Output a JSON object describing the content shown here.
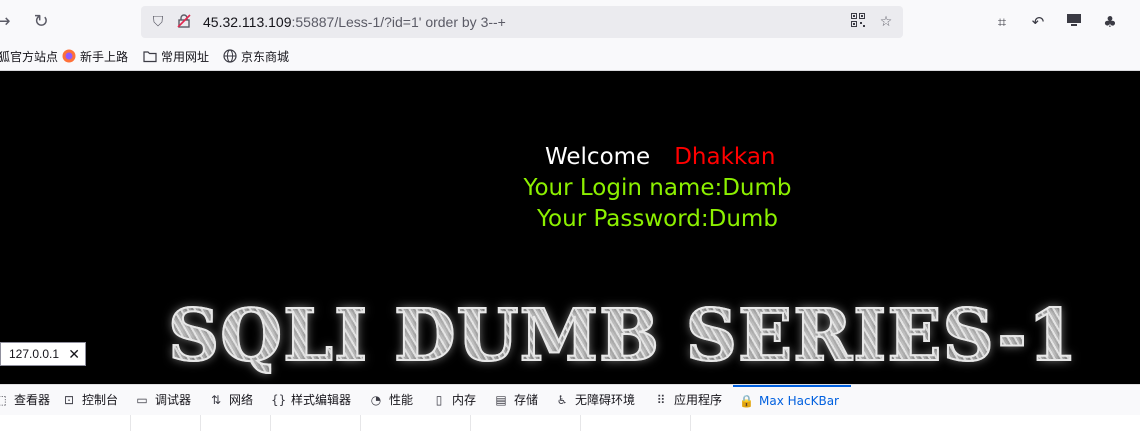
{
  "toolbar": {
    "back_icon": "arrow-right-icon",
    "reload_icon": "reload-icon",
    "url_host": "45.32.113.109",
    "url_rest": ":55887/Less-1/?id=1' order by 3--+"
  },
  "bookmarks": [
    {
      "label": "火狐官方站点",
      "icon": "firefox-icon"
    },
    {
      "label": "新手上路",
      "icon": "firefox-icon"
    },
    {
      "label": "常用网址",
      "icon": "folder-icon"
    },
    {
      "label": "京东商城",
      "icon": "globe-icon"
    }
  ],
  "page": {
    "welcome": "Welcome",
    "name": "Dhakkan",
    "login_line": "Your Login name:Dumb",
    "password_line": "Your Password:Dumb",
    "banner": "SQLI DUMB SERIES-1",
    "ip": "127.0.0.1"
  },
  "devtools": {
    "tabs": [
      {
        "label": "查看器",
        "icon": "inspector-icon"
      },
      {
        "label": "控制台",
        "icon": "console-icon"
      },
      {
        "label": "调试器",
        "icon": "debugger-icon"
      },
      {
        "label": "网络",
        "icon": "network-icon"
      },
      {
        "label": "样式编辑器",
        "icon": "style-editor-icon"
      },
      {
        "label": "性能",
        "icon": "performance-icon"
      },
      {
        "label": "内存",
        "icon": "memory-icon"
      },
      {
        "label": "存储",
        "icon": "storage-icon"
      },
      {
        "label": "无障碍环境",
        "icon": "accessibility-icon"
      },
      {
        "label": "应用程序",
        "icon": "application-icon"
      },
      {
        "label": "Max HacKBar",
        "icon": "hackbar-icon"
      }
    ]
  },
  "colors": {
    "page_bg": "#000000",
    "welcome": "#ffffff",
    "name": "#ff0000",
    "credentials": "#8cf000",
    "active_tab": "#0060df"
  }
}
